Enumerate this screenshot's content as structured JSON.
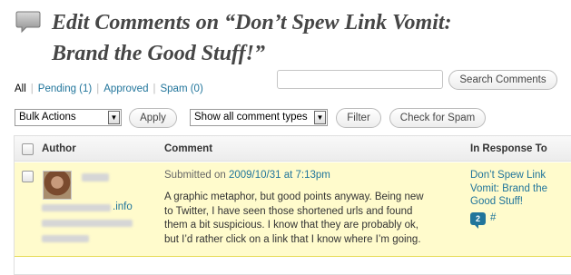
{
  "header": {
    "title": "Edit Comments on “Don’t Spew Link Vomit: Brand the Good Stuff!”",
    "icon": "comments-icon"
  },
  "filters": {
    "all_label": "All",
    "pending_label": "Pending (1)",
    "approved_label": "Approved",
    "spam_label": "Spam (0)"
  },
  "search": {
    "value": "",
    "button_label": "Search Comments"
  },
  "toolbar": {
    "bulk_action_selected": "Bulk Actions",
    "apply_label": "Apply",
    "comment_type_selected": "Show all comment types",
    "filter_label": "Filter",
    "check_spam_label": "Check for Spam"
  },
  "table": {
    "columns": [
      "Author",
      "Comment",
      "In Response To"
    ],
    "rows": [
      {
        "author_url_suffix": ".info",
        "submitted_prefix": "Submitted on",
        "submitted_date": "2009/10/31 at 7:13pm",
        "comment": "A graphic metaphor, but good points anyway. Being new to Twitter, I have seen those shortened urls and found them a bit suspicious. I know that they are probably ok, but I’d rather click on a link that I know where I’m going.",
        "response_title": "Don’t Spew Link Vomit: Brand the Good Stuff!",
        "comment_count": "2",
        "permalink": "#"
      }
    ]
  },
  "colors": {
    "link": "#21759b",
    "pending_row_bg": "#fffbcc"
  }
}
